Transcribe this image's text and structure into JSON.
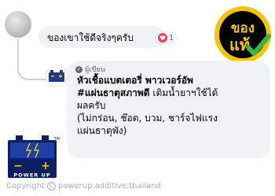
{
  "comment": {
    "text": "ของเขาใช้ดีจริงๆครับ",
    "reaction_count": "1",
    "reaction_icon": "heart-icon",
    "reaction_color": "#f33e58"
  },
  "badge": {
    "line1": "ของ",
    "line2": "แท้",
    "icon": "checkmark-icon",
    "colors": {
      "ring": "#f7c500",
      "center": "#000000",
      "check": "#39b54a"
    }
  },
  "reply": {
    "author_tag": "ผู้เขียน",
    "title": "หัวเชื้อแบตเตอรี่ พาวเวอร์อัพ",
    "hashtag": "#แผ่นธาตุสภาพดี",
    "line2_rest": " เติมน้ำยาฯใช้ได้",
    "line3": "ผลครับ",
    "line4": "(ไม่กร่อน, ช๊อต, บวม, ชาร์จไฟแรง",
    "line5": "แผ่นธาตุพัง)"
  },
  "brand": {
    "logo_text": "POWER UP",
    "trademark": "TM",
    "minus": "−",
    "plus": "+"
  },
  "footer": {
    "copyright": "Copyright",
    "handle": "powerup.additive.thailand"
  }
}
